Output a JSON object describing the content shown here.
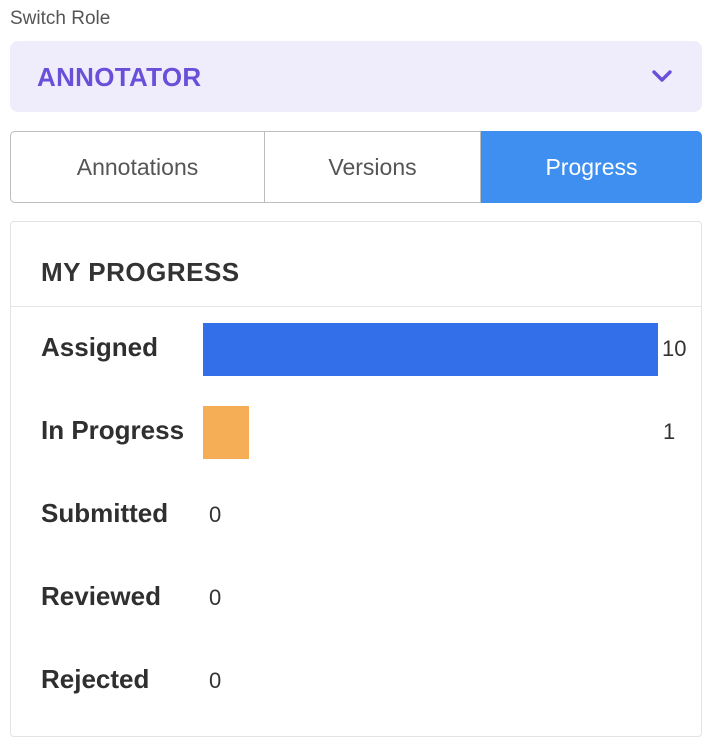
{
  "switch_role": {
    "label": "Switch Role",
    "selected": "ANNOTATOR"
  },
  "tabs": [
    {
      "label": "Annotations",
      "active": false
    },
    {
      "label": "Versions",
      "active": false
    },
    {
      "label": "Progress",
      "active": true
    }
  ],
  "progress": {
    "title": "MY PROGRESS",
    "rows": [
      {
        "label": "Assigned",
        "value": "10",
        "color": "#336fe8"
      },
      {
        "label": "In Progress",
        "value": "1",
        "color": "#f5ae55"
      },
      {
        "label": "Submitted",
        "value": "0",
        "color": "#336fe8"
      },
      {
        "label": "Reviewed",
        "value": "0",
        "color": "#336fe8"
      },
      {
        "label": "Rejected",
        "value": "0",
        "color": "#336fe8"
      }
    ]
  },
  "colors": {
    "accent": "#3e8ff0",
    "role_bg": "#efedfc",
    "role_text": "#6a4fd8"
  }
}
